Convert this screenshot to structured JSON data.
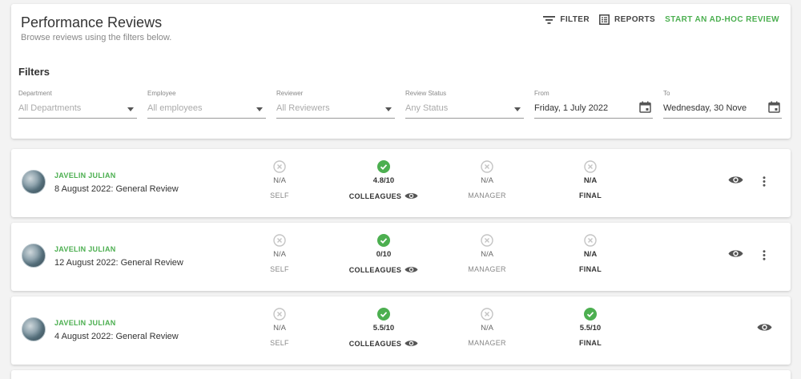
{
  "header": {
    "title": "Performance Reviews",
    "subtitle": "Browse reviews using the filters below.",
    "filter_label": "FILTER",
    "reports_label": "REPORTS",
    "adhoc_label": "START AN AD-HOC REVIEW"
  },
  "filters": {
    "title": "Filters",
    "department": {
      "label": "Department",
      "value": "All Departments"
    },
    "employee": {
      "label": "Employee",
      "value": "All employees"
    },
    "reviewer": {
      "label": "Reviewer",
      "value": "All Reviewers"
    },
    "status": {
      "label": "Review Status",
      "value": "Any Status"
    },
    "from": {
      "label": "From",
      "value": "Friday, 1 July 2022"
    },
    "to": {
      "label": "To",
      "value": "Wednesday, 30 Nove"
    }
  },
  "reviews": [
    {
      "name": "JAVELIN JULIAN",
      "title": "8 August 2022: General Review",
      "self": {
        "score": "N/A",
        "label": "SELF"
      },
      "colleagues": {
        "score": "4.8/10",
        "label": "COLLEAGUES"
      },
      "manager": {
        "score": "N/A",
        "label": "MANAGER"
      },
      "final": {
        "score": "N/A",
        "label": "FINAL"
      }
    },
    {
      "name": "JAVELIN JULIAN",
      "title": "12 August 2022: General Review",
      "self": {
        "score": "N/A",
        "label": "SELF"
      },
      "colleagues": {
        "score": "0/10",
        "label": "COLLEAGUES"
      },
      "manager": {
        "score": "N/A",
        "label": "MANAGER"
      },
      "final": {
        "score": "N/A",
        "label": "FINAL"
      }
    },
    {
      "name": "JAVELIN JULIAN",
      "title": "4 August 2022: General Review",
      "self": {
        "score": "N/A",
        "label": "SELF"
      },
      "colleagues": {
        "score": "5.5/10",
        "label": "COLLEAGUES"
      },
      "manager": {
        "score": "N/A",
        "label": "MANAGER"
      },
      "final": {
        "score": "5.5/10",
        "label": "FINAL"
      }
    }
  ],
  "icons": {
    "done": "check-circle-icon",
    "pending": "cancel-circle-icon",
    "view": "eye-icon",
    "more": "more-vert-icon"
  },
  "colors": {
    "accent": "#4caf50",
    "muted": "#c4c4c4"
  }
}
